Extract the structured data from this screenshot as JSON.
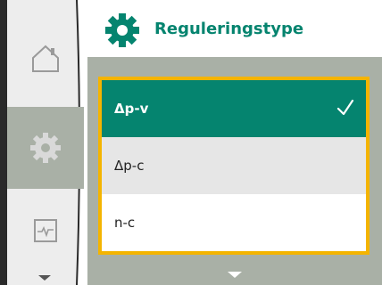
{
  "header": {
    "title": "Reguleringstype",
    "icon": "gear-icon",
    "accent_color": "#05846f"
  },
  "sidebar": {
    "items": [
      {
        "name": "home",
        "icon": "home-icon",
        "active": false
      },
      {
        "name": "settings",
        "icon": "gear-icon",
        "active": true
      },
      {
        "name": "monitor",
        "icon": "pulse-icon",
        "active": false
      }
    ],
    "more_icon": "chevron-down-icon"
  },
  "options": [
    {
      "label": "Δp-v",
      "selected": true
    },
    {
      "label": "Δp-c",
      "selected": false
    },
    {
      "label": "n-c",
      "selected": false
    }
  ],
  "colors": {
    "selected_bg": "#05846f",
    "focus_border": "#f4b400",
    "panel_bg": "#a9b0a6",
    "sidebar_bg": "#ededed"
  }
}
